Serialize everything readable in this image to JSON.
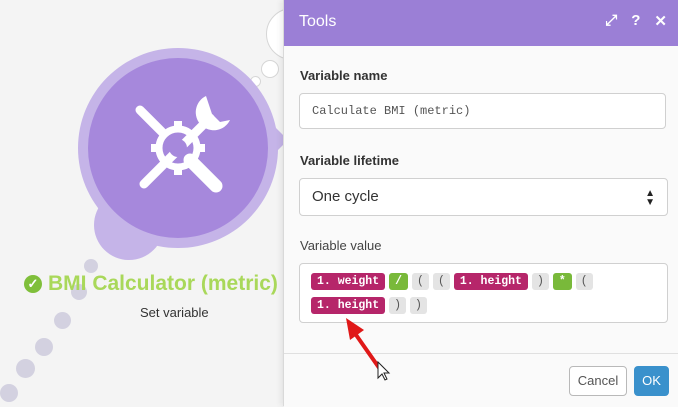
{
  "canvas": {
    "module": {
      "title": "BMI Calculator (metric)",
      "subtitle": "Set variable",
      "icon": "tools-icon",
      "accent": "#a688dc",
      "status": "success"
    }
  },
  "dialog": {
    "title": "Tools",
    "header_icons": [
      "expand-icon",
      "help-icon",
      "close-icon"
    ],
    "header_glyphs": {
      "expand": "⤢",
      "help": "?",
      "close": "✕"
    },
    "variable_name": {
      "label": "Variable name",
      "value": "Calculate BMI (metric)"
    },
    "variable_lifetime": {
      "label": "Variable lifetime",
      "selected": "One cycle"
    },
    "variable_value": {
      "label": "Variable value",
      "tokens_row1": [
        {
          "type": "var",
          "text": "1. weight"
        },
        {
          "type": "op",
          "text": "/"
        },
        {
          "type": "paren",
          "text": "("
        },
        {
          "type": "paren",
          "text": "("
        },
        {
          "type": "var",
          "text": "1. height"
        },
        {
          "type": "paren",
          "text": ")"
        },
        {
          "type": "op",
          "text": "*"
        },
        {
          "type": "paren",
          "text": "("
        }
      ],
      "tokens_row2": [
        {
          "type": "var",
          "text": "1. height"
        },
        {
          "type": "paren",
          "text": ")"
        },
        {
          "type": "paren",
          "text": ")"
        }
      ]
    },
    "buttons": {
      "cancel": "Cancel",
      "ok": "OK"
    }
  },
  "colors": {
    "header": "#9b7fd6",
    "variable_pill": "#b6266a",
    "operator_pill": "#79b93a",
    "ok_button": "#3a91cc",
    "title_green": "#a9d85a"
  }
}
